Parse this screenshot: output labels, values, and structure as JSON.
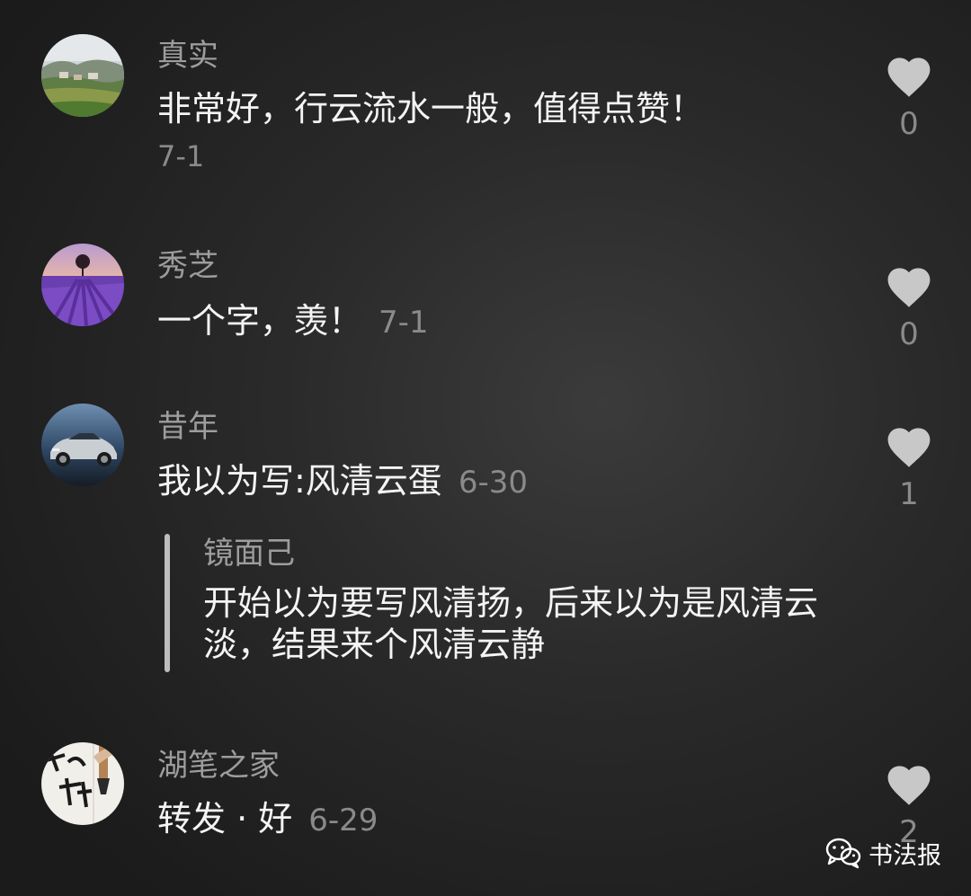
{
  "comments": [
    {
      "name": "真实",
      "text": "非常好，行云流水一般，值得点赞！",
      "date": "7-1",
      "likes": "0",
      "avatar": "village-landscape-avatar"
    },
    {
      "name": "秀芝",
      "text": "一个字，羡！",
      "date": "7-1",
      "likes": "0",
      "avatar": "lavender-field-avatar"
    },
    {
      "name": "昔年",
      "text": "我以为写:风清云蛋",
      "date": "6-30",
      "likes": "1",
      "avatar": "sports-car-avatar",
      "reply": {
        "name": "镜面己",
        "text": "开始以为要写风清扬，后来以为是风清云淡，结果来个风清云静"
      }
    },
    {
      "name": "湖笔之家",
      "text": "转发 · 好",
      "date": "6-29",
      "likes": "2",
      "avatar": "calligraphy-brush-avatar"
    }
  ],
  "watermark": {
    "icon": "wechat-icon",
    "label": "书法报"
  },
  "colors": {
    "background": "#2a2a2a",
    "name": "#9d9d9d",
    "text": "#f4f4f4",
    "date": "#8a8a8a",
    "heart": "#c8c8c8",
    "reply_bar": "#bdbdbd"
  }
}
